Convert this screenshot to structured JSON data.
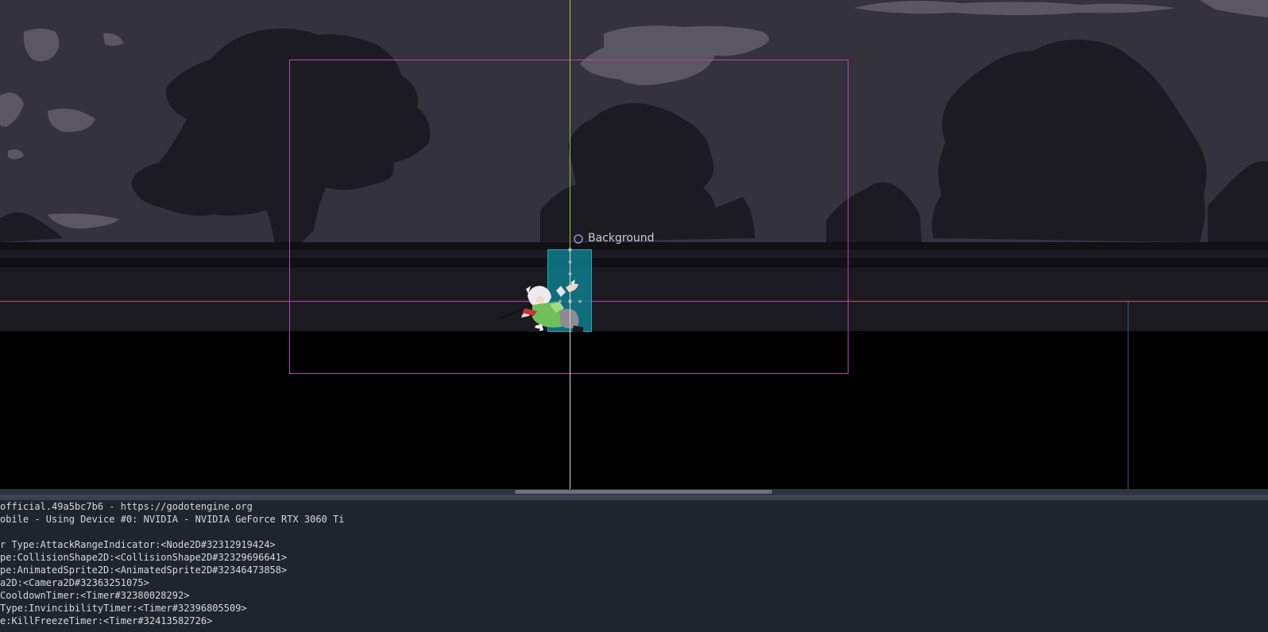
{
  "viewport": {
    "background_node_label": "Background",
    "colors": {
      "sky": "#34323c",
      "silhouette": "#1c1b21",
      "cloud": "#5a5664",
      "ground_dark": "#111014",
      "ground_mid": "#1b1a20",
      "camera_rect": "#b544b8",
      "collision_shape": "#0e7c8c",
      "axis_x": "#d24a55",
      "axis_y": "#9ec33f",
      "guide": "#4a4c92"
    }
  },
  "output": {
    "lines": [
      "official.49a5bc7b6 - https://godotengine.org",
      "obile - Using Device #0: NVIDIA - NVIDIA GeForce RTX 3060 Ti",
      "",
      "r Type:AttackRangeIndicator:<Node2D#32312919424>",
      "pe:CollisionShape2D:<CollisionShape2D#32329696641>",
      "pe:AnimatedSprite2D:<AnimatedSprite2D#32346473858>",
      "a2D:<Camera2D#32363251075>",
      "CooldownTimer:<Timer#32380028292>",
      "Type:InvincibilityTimer:<Timer#32396805509>",
      "e:KillFreezeTimer:<Timer#32413582726>"
    ]
  }
}
